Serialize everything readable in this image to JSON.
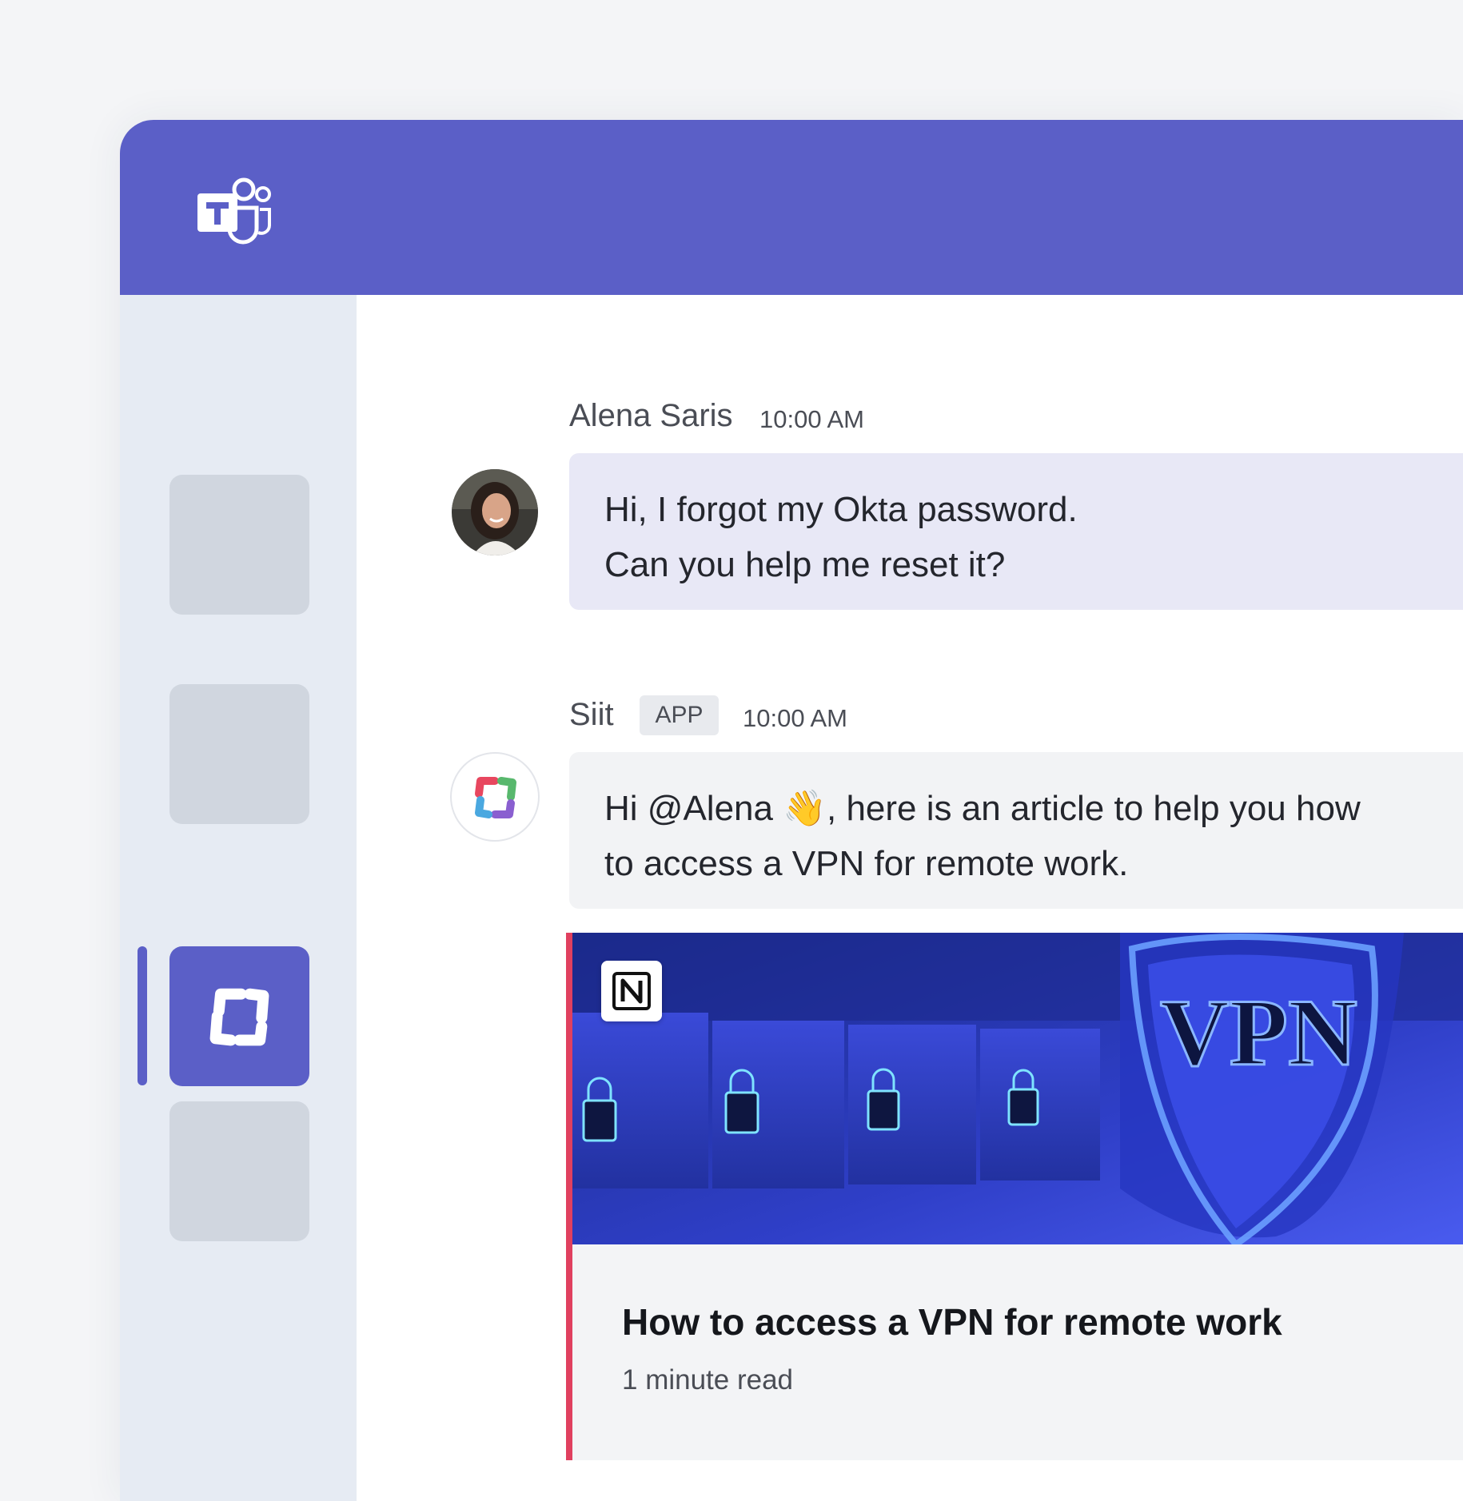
{
  "app": {
    "name": "Microsoft Teams",
    "brand_color": "#5b5fc7",
    "logo_icon": "teams-logo-icon"
  },
  "sidebar": {
    "items": [
      {
        "name": "sidebar-item-1",
        "active": false
      },
      {
        "name": "sidebar-item-2",
        "active": false
      },
      {
        "name": "sidebar-item-siit",
        "active": true,
        "icon": "siit-logo-icon"
      },
      {
        "name": "sidebar-item-4",
        "active": false
      }
    ]
  },
  "messages": [
    {
      "sender": "Alena Saris",
      "time": "10:00 AM",
      "avatar": "user-avatar-photo",
      "lines": [
        "Hi, I forgot my Okta password.",
        "Can you help me reset it?"
      ]
    },
    {
      "sender": "Siit",
      "badge": "APP",
      "time": "10:00 AM",
      "avatar": "siit-logo-icon",
      "line1_a": "Hi @Alena ",
      "line1_emoji": "👋",
      "line1_b": ", here is an article to help you how",
      "line2": "to access a VPN for remote work."
    }
  ],
  "article": {
    "source_icon": "notion-icon",
    "image_text": "VPN",
    "title": "How to access a VPN for remote work",
    "meta": "1 minute read",
    "accent_color": "#e0405f"
  }
}
